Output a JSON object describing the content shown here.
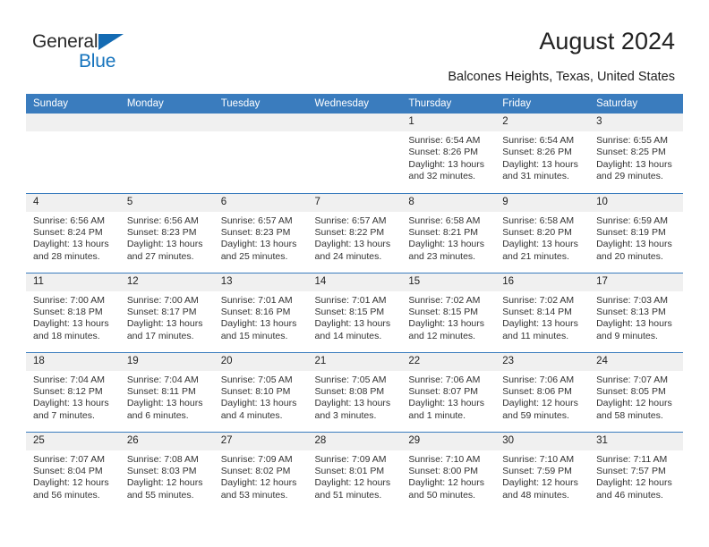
{
  "brand": {
    "word1": "General",
    "word2": "Blue",
    "triangle_color": "#146bb3",
    "blue_color": "#1573bd"
  },
  "header": {
    "title": "August 2024",
    "subtitle": "Balcones Heights, Texas, United States"
  },
  "theme": {
    "header_bg": "#3a7cbe",
    "header_text": "#ffffff",
    "daynum_bg": "#f0f0f0",
    "cell_bg": "#ffffff",
    "border": "#3a7cbe"
  },
  "weekdays": [
    "Sunday",
    "Monday",
    "Tuesday",
    "Wednesday",
    "Thursday",
    "Friday",
    "Saturday"
  ],
  "weeks": [
    [
      {
        "day": "",
        "empty": true
      },
      {
        "day": "",
        "empty": true
      },
      {
        "day": "",
        "empty": true
      },
      {
        "day": "",
        "empty": true
      },
      {
        "day": "1",
        "sunrise": "Sunrise: 6:54 AM",
        "sunset": "Sunset: 8:26 PM",
        "daylight1": "Daylight: 13 hours",
        "daylight2": "and 32 minutes."
      },
      {
        "day": "2",
        "sunrise": "Sunrise: 6:54 AM",
        "sunset": "Sunset: 8:26 PM",
        "daylight1": "Daylight: 13 hours",
        "daylight2": "and 31 minutes."
      },
      {
        "day": "3",
        "sunrise": "Sunrise: 6:55 AM",
        "sunset": "Sunset: 8:25 PM",
        "daylight1": "Daylight: 13 hours",
        "daylight2": "and 29 minutes."
      }
    ],
    [
      {
        "day": "4",
        "sunrise": "Sunrise: 6:56 AM",
        "sunset": "Sunset: 8:24 PM",
        "daylight1": "Daylight: 13 hours",
        "daylight2": "and 28 minutes."
      },
      {
        "day": "5",
        "sunrise": "Sunrise: 6:56 AM",
        "sunset": "Sunset: 8:23 PM",
        "daylight1": "Daylight: 13 hours",
        "daylight2": "and 27 minutes."
      },
      {
        "day": "6",
        "sunrise": "Sunrise: 6:57 AM",
        "sunset": "Sunset: 8:23 PM",
        "daylight1": "Daylight: 13 hours",
        "daylight2": "and 25 minutes."
      },
      {
        "day": "7",
        "sunrise": "Sunrise: 6:57 AM",
        "sunset": "Sunset: 8:22 PM",
        "daylight1": "Daylight: 13 hours",
        "daylight2": "and 24 minutes."
      },
      {
        "day": "8",
        "sunrise": "Sunrise: 6:58 AM",
        "sunset": "Sunset: 8:21 PM",
        "daylight1": "Daylight: 13 hours",
        "daylight2": "and 23 minutes."
      },
      {
        "day": "9",
        "sunrise": "Sunrise: 6:58 AM",
        "sunset": "Sunset: 8:20 PM",
        "daylight1": "Daylight: 13 hours",
        "daylight2": "and 21 minutes."
      },
      {
        "day": "10",
        "sunrise": "Sunrise: 6:59 AM",
        "sunset": "Sunset: 8:19 PM",
        "daylight1": "Daylight: 13 hours",
        "daylight2": "and 20 minutes."
      }
    ],
    [
      {
        "day": "11",
        "sunrise": "Sunrise: 7:00 AM",
        "sunset": "Sunset: 8:18 PM",
        "daylight1": "Daylight: 13 hours",
        "daylight2": "and 18 minutes."
      },
      {
        "day": "12",
        "sunrise": "Sunrise: 7:00 AM",
        "sunset": "Sunset: 8:17 PM",
        "daylight1": "Daylight: 13 hours",
        "daylight2": "and 17 minutes."
      },
      {
        "day": "13",
        "sunrise": "Sunrise: 7:01 AM",
        "sunset": "Sunset: 8:16 PM",
        "daylight1": "Daylight: 13 hours",
        "daylight2": "and 15 minutes."
      },
      {
        "day": "14",
        "sunrise": "Sunrise: 7:01 AM",
        "sunset": "Sunset: 8:15 PM",
        "daylight1": "Daylight: 13 hours",
        "daylight2": "and 14 minutes."
      },
      {
        "day": "15",
        "sunrise": "Sunrise: 7:02 AM",
        "sunset": "Sunset: 8:15 PM",
        "daylight1": "Daylight: 13 hours",
        "daylight2": "and 12 minutes."
      },
      {
        "day": "16",
        "sunrise": "Sunrise: 7:02 AM",
        "sunset": "Sunset: 8:14 PM",
        "daylight1": "Daylight: 13 hours",
        "daylight2": "and 11 minutes."
      },
      {
        "day": "17",
        "sunrise": "Sunrise: 7:03 AM",
        "sunset": "Sunset: 8:13 PM",
        "daylight1": "Daylight: 13 hours",
        "daylight2": "and 9 minutes."
      }
    ],
    [
      {
        "day": "18",
        "sunrise": "Sunrise: 7:04 AM",
        "sunset": "Sunset: 8:12 PM",
        "daylight1": "Daylight: 13 hours",
        "daylight2": "and 7 minutes."
      },
      {
        "day": "19",
        "sunrise": "Sunrise: 7:04 AM",
        "sunset": "Sunset: 8:11 PM",
        "daylight1": "Daylight: 13 hours",
        "daylight2": "and 6 minutes."
      },
      {
        "day": "20",
        "sunrise": "Sunrise: 7:05 AM",
        "sunset": "Sunset: 8:10 PM",
        "daylight1": "Daylight: 13 hours",
        "daylight2": "and 4 minutes."
      },
      {
        "day": "21",
        "sunrise": "Sunrise: 7:05 AM",
        "sunset": "Sunset: 8:08 PM",
        "daylight1": "Daylight: 13 hours",
        "daylight2": "and 3 minutes."
      },
      {
        "day": "22",
        "sunrise": "Sunrise: 7:06 AM",
        "sunset": "Sunset: 8:07 PM",
        "daylight1": "Daylight: 13 hours",
        "daylight2": "and 1 minute."
      },
      {
        "day": "23",
        "sunrise": "Sunrise: 7:06 AM",
        "sunset": "Sunset: 8:06 PM",
        "daylight1": "Daylight: 12 hours",
        "daylight2": "and 59 minutes."
      },
      {
        "day": "24",
        "sunrise": "Sunrise: 7:07 AM",
        "sunset": "Sunset: 8:05 PM",
        "daylight1": "Daylight: 12 hours",
        "daylight2": "and 58 minutes."
      }
    ],
    [
      {
        "day": "25",
        "sunrise": "Sunrise: 7:07 AM",
        "sunset": "Sunset: 8:04 PM",
        "daylight1": "Daylight: 12 hours",
        "daylight2": "and 56 minutes."
      },
      {
        "day": "26",
        "sunrise": "Sunrise: 7:08 AM",
        "sunset": "Sunset: 8:03 PM",
        "daylight1": "Daylight: 12 hours",
        "daylight2": "and 55 minutes."
      },
      {
        "day": "27",
        "sunrise": "Sunrise: 7:09 AM",
        "sunset": "Sunset: 8:02 PM",
        "daylight1": "Daylight: 12 hours",
        "daylight2": "and 53 minutes."
      },
      {
        "day": "28",
        "sunrise": "Sunrise: 7:09 AM",
        "sunset": "Sunset: 8:01 PM",
        "daylight1": "Daylight: 12 hours",
        "daylight2": "and 51 minutes."
      },
      {
        "day": "29",
        "sunrise": "Sunrise: 7:10 AM",
        "sunset": "Sunset: 8:00 PM",
        "daylight1": "Daylight: 12 hours",
        "daylight2": "and 50 minutes."
      },
      {
        "day": "30",
        "sunrise": "Sunrise: 7:10 AM",
        "sunset": "Sunset: 7:59 PM",
        "daylight1": "Daylight: 12 hours",
        "daylight2": "and 48 minutes."
      },
      {
        "day": "31",
        "sunrise": "Sunrise: 7:11 AM",
        "sunset": "Sunset: 7:57 PM",
        "daylight1": "Daylight: 12 hours",
        "daylight2": "and 46 minutes."
      }
    ]
  ]
}
